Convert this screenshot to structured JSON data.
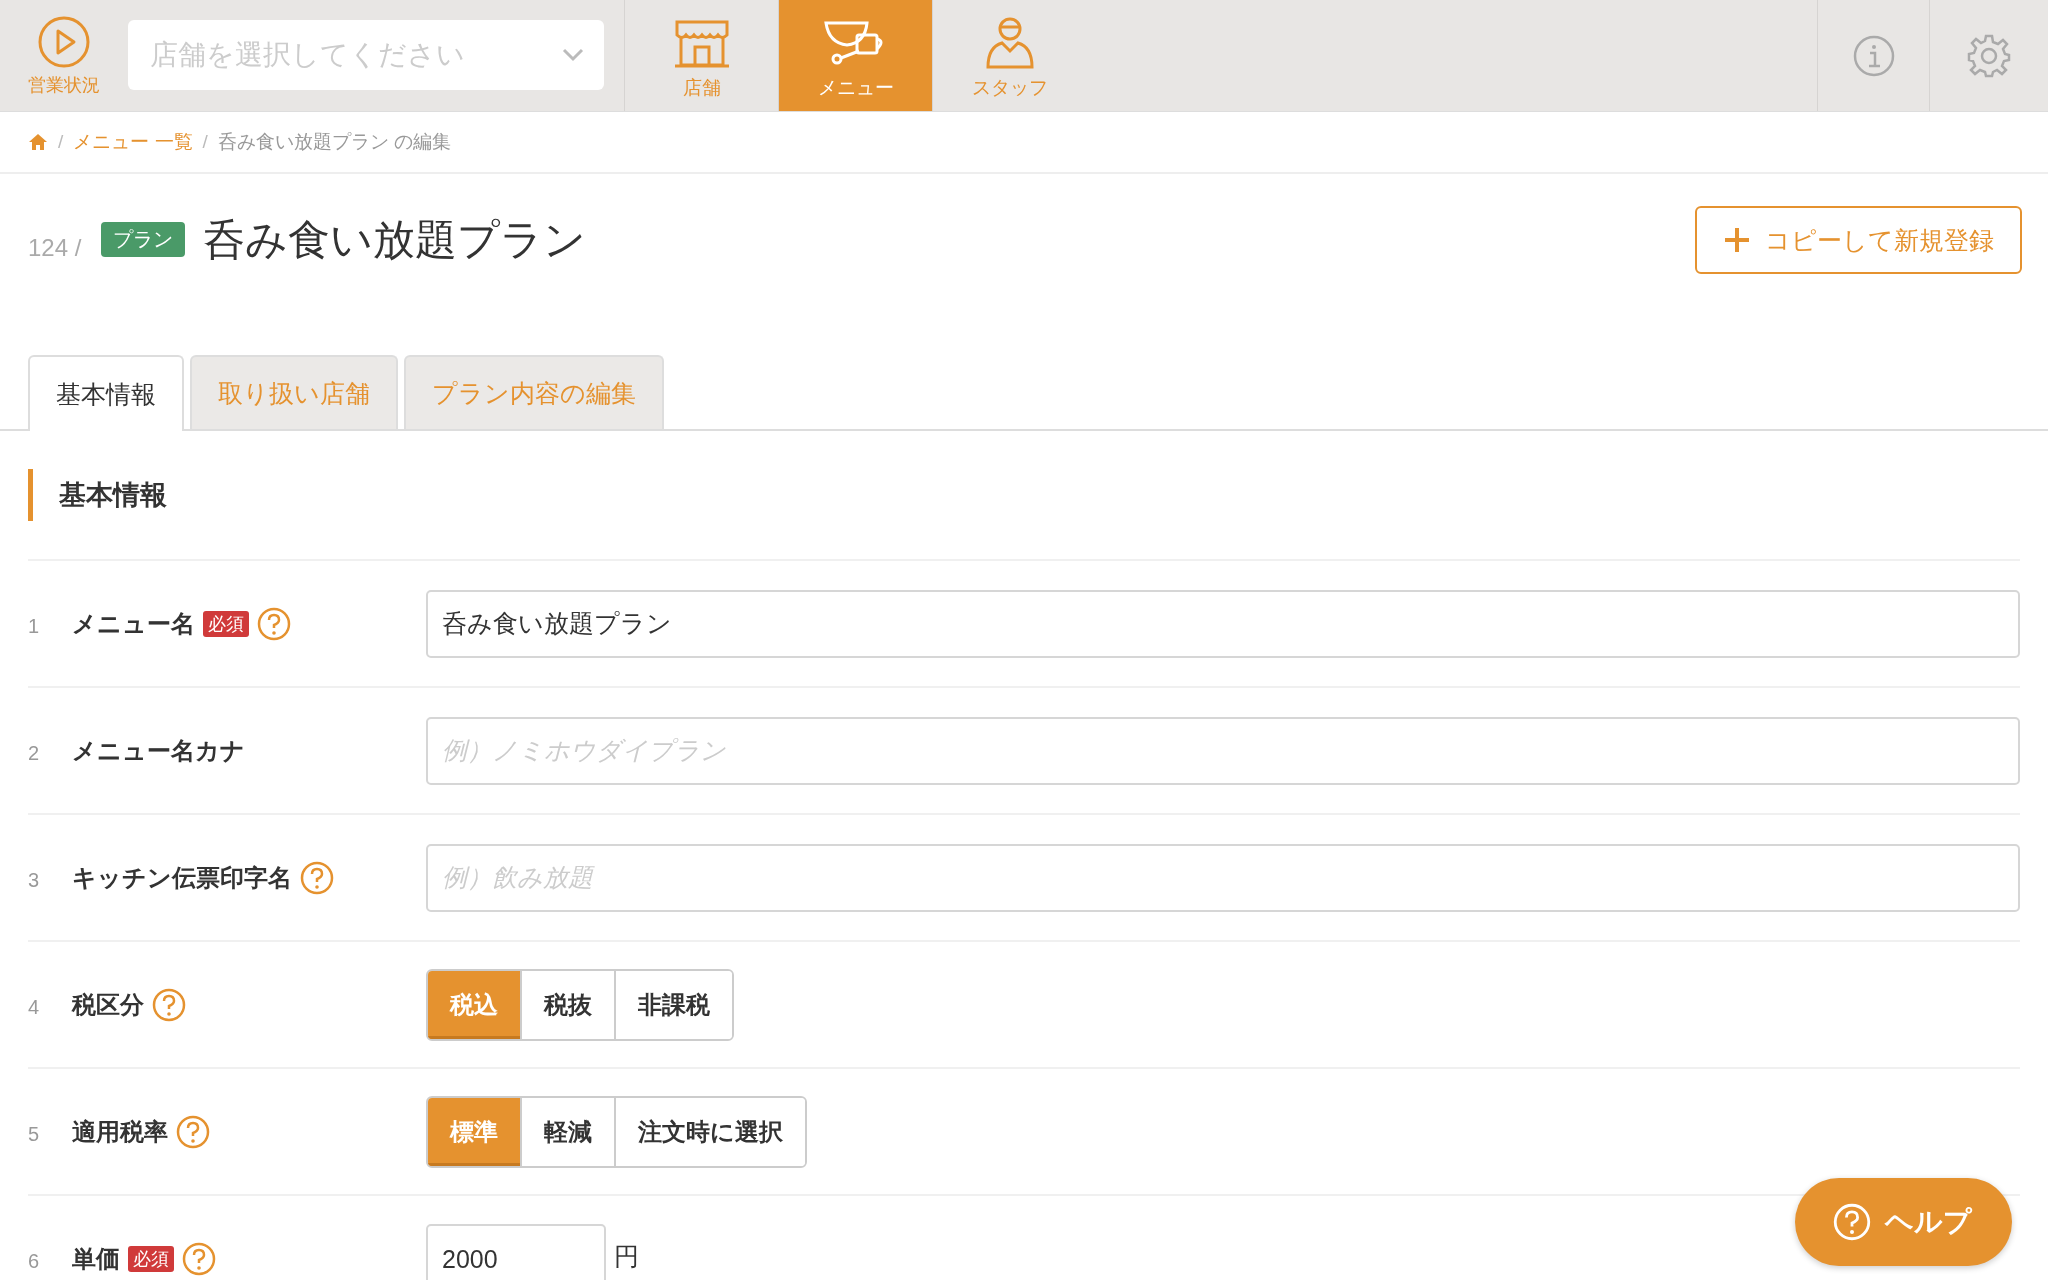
{
  "topbar": {
    "status": {
      "label": "営業状況"
    },
    "store_select": {
      "placeholder": "店舗を選択してください"
    },
    "nav": [
      {
        "kind": "store",
        "label": "店舗",
        "selected": false
      },
      {
        "kind": "menu",
        "label": "メニュー",
        "selected": true
      },
      {
        "kind": "staff",
        "label": "スタッフ",
        "selected": false
      }
    ]
  },
  "breadcrumb": [
    {
      "kind": "link",
      "separator": "/",
      "label": "メニュー 一覧"
    },
    {
      "kind": "current",
      "separator": "/",
      "label": "呑み食い放題プラン の編集"
    }
  ],
  "header": {
    "id": "124 /",
    "badge": "プラン",
    "title": "呑み食い放題プラン",
    "copy_button": "コピーして新規登録"
  },
  "tabs": [
    {
      "label": "基本情報",
      "selected": true
    },
    {
      "label": "取り扱い店舗",
      "selected": false
    },
    {
      "label": "プラン内容の編集",
      "selected": false
    }
  ],
  "section": {
    "heading": "基本情報"
  },
  "rows": [
    {
      "number": "1",
      "label": "メニュー名",
      "required_badge": "必須",
      "help": true,
      "kind": "text",
      "value": "呑み食い放題プラン"
    },
    {
      "number": "2",
      "label": "メニュー名カナ",
      "help": false,
      "kind": "text",
      "placeholder": "例）ノミホウダイプラン"
    },
    {
      "number": "3",
      "label": "キッチン伝票印字名",
      "help": true,
      "kind": "text",
      "placeholder": "例）飲み放題"
    },
    {
      "number": "4",
      "label": "税区分",
      "help": true,
      "kind": "segmented",
      "options": [
        {
          "label": "税込",
          "selected": true
        },
        {
          "label": "税抜",
          "selected": false
        },
        {
          "label": "非課税",
          "selected": false
        }
      ]
    },
    {
      "number": "5",
      "label": "適用税率",
      "help": true,
      "kind": "segmented",
      "options": [
        {
          "label": "標準",
          "selected": true
        },
        {
          "label": "軽減",
          "selected": false
        },
        {
          "label": "注文時に選択",
          "selected": false
        }
      ]
    },
    {
      "number": "6",
      "label": "単価",
      "required_badge": "必須",
      "help": true,
      "kind": "price",
      "value": "2000",
      "unit": "円"
    }
  ],
  "help_button": {
    "label": "ヘルプ"
  }
}
